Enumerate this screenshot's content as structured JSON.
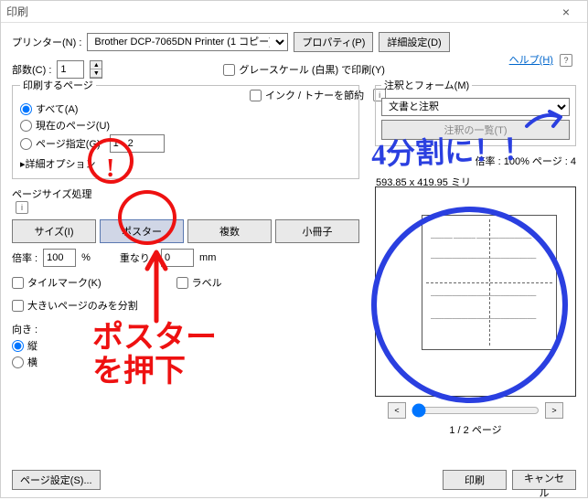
{
  "window": {
    "title": "印刷"
  },
  "printer": {
    "label": "プリンター(N) :",
    "value": "Brother DCP-7065DN Printer (1 コピー)",
    "prop_btn": "プロパティ(P)",
    "adv_btn": "詳細設定(D)"
  },
  "help": {
    "text": "ヘルプ(H)"
  },
  "copies": {
    "label": "部数(C) :",
    "value": "1"
  },
  "gray": {
    "label": "グレースケール (白黒) で印刷(Y)"
  },
  "ink": {
    "label": "インク / トナーを節約"
  },
  "print_pages": {
    "legend": "印刷するページ",
    "all": "すべて(A)",
    "current": "現在のページ(U)",
    "range": "ページ指定(G)",
    "range_example": "1 - 2",
    "detail": "詳細オプション"
  },
  "annot": {
    "legend": "注釈とフォーム(M)",
    "value": "文書と注釈",
    "summary": "注釈の一覧(T)"
  },
  "sizing": {
    "legend": "ページサイズ処理",
    "size": "サイズ(I)",
    "poster": "ポスター",
    "multi": "複数",
    "booklet": "小冊子"
  },
  "scale": {
    "label": "倍率 :",
    "value": "100",
    "pct": "%",
    "overlap": "重なり :",
    "overlap_val": "0",
    "mm": "mm"
  },
  "tile": {
    "label": "タイルマーク(K)"
  },
  "labels": {
    "label": "ラベル"
  },
  "bigonly": {
    "label": "大きいページのみを分割"
  },
  "orient": {
    "legend": "向き :",
    "port": "縦",
    "land": "横"
  },
  "preview": {
    "size": "593.85 x 419.95 ミリ",
    "scale_note": "倍率 : 100% ページ : 4",
    "nav": "1 / 2 ページ"
  },
  "footer": {
    "pagesetup": "ページ設定(S)...",
    "print": "印刷",
    "cancel": "キャンセル"
  },
  "annotations": {
    "red_text": "ポスター\nを押下",
    "blue_text": "4分割に！！"
  }
}
